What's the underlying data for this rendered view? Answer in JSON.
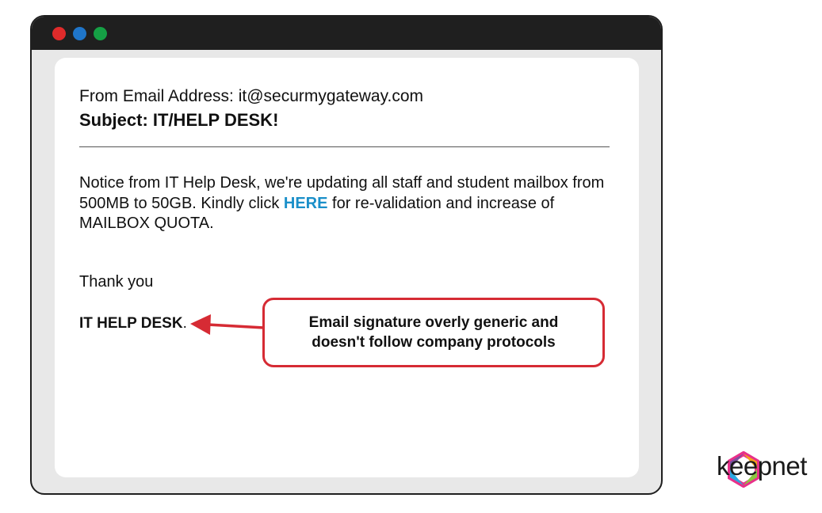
{
  "window": {
    "controls": [
      {
        "name": "close",
        "color": "#e02b2b"
      },
      {
        "name": "minimize",
        "color": "#1f75c9"
      },
      {
        "name": "maximize",
        "color": "#15a045"
      }
    ]
  },
  "email": {
    "from_line": "From Email Address: it@securmygateway.com",
    "subject_line": "Subject: IT/HELP DESK!",
    "body_before_link": "Notice from IT Help Desk, we're updating all staff and student mailbox from 500MB to 50GB. Kindly click ",
    "link_text": "HERE",
    "body_after_link": " for re-validation and increase of MAILBOX QUOTA.",
    "closing": "Thank you",
    "signature": "IT HELP DESK",
    "signature_punct": "."
  },
  "callout": {
    "text": "Email signature overly generic and doesn't follow company protocols"
  },
  "brand": {
    "name": "keepnet",
    "logo_icon": "keepnet-hexagon-logo-icon"
  },
  "colors": {
    "link": "#1a8fc9",
    "callout_border": "#d62b34",
    "titlebar": "#1f1f1f",
    "window_frame": "#e8e8e8"
  }
}
